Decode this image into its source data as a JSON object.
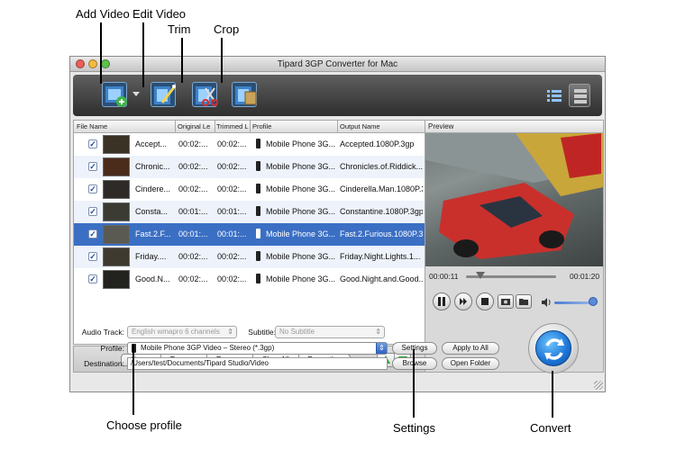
{
  "callouts": {
    "add_video": "Add Video",
    "edit_video": "Edit Video",
    "trim": "Trim",
    "crop": "Crop",
    "choose_profile": "Choose profile",
    "settings": "Settings",
    "convert": "Convert"
  },
  "window": {
    "title": "Tipard 3GP Converter for Mac"
  },
  "toolbar": {
    "icons": [
      "add-video-icon",
      "edit-video-icon",
      "trim-icon",
      "crop-icon",
      "snapshot-icon"
    ],
    "view_icons": [
      "list-view-icon",
      "detail-view-icon"
    ]
  },
  "file_list": {
    "headers": [
      "File Name",
      "Original Le",
      "Trimmed L",
      "Profile",
      "Output Name"
    ],
    "rows": [
      {
        "name": "Accept...",
        "original": "00:02:...",
        "trimmed": "00:02:...",
        "profile": "Mobile Phone 3G...",
        "output": "Accepted.1080P.3gp"
      },
      {
        "name": "Chronic...",
        "original": "00:02:...",
        "trimmed": "00:02:...",
        "profile": "Mobile Phone 3G...",
        "output": "Chronicles.of.Riddick...."
      },
      {
        "name": "Cindere...",
        "original": "00:02:...",
        "trimmed": "00:02:...",
        "profile": "Mobile Phone 3G...",
        "output": "Cinderella.Man.1080P.3..."
      },
      {
        "name": "Consta...",
        "original": "00:01:...",
        "trimmed": "00:01:...",
        "profile": "Mobile Phone 3G...",
        "output": "Constantine.1080P.3gp"
      },
      {
        "name": "Fast.2.F...",
        "original": "00:01:...",
        "trimmed": "00:01:...",
        "profile": "Mobile Phone 3G...",
        "output": "Fast.2.Furious.1080P.3gp"
      },
      {
        "name": "Friday....",
        "original": "00:02:...",
        "trimmed": "00:02:...",
        "profile": "Mobile Phone 3G...",
        "output": "Friday.Night.Lights.1..."
      },
      {
        "name": "Good.N...",
        "original": "00:02:...",
        "trimmed": "00:02:...",
        "profile": "Mobile Phone 3G...",
        "output": "Good.Night.and.Good..."
      }
    ],
    "selected_row": 4
  },
  "list_actions": {
    "merge": "Merge",
    "rename": "Rename",
    "remove": "Remove",
    "clear_all": "Clear All",
    "properties": "Properties"
  },
  "preview": {
    "header": "Preview",
    "time_current": "00:00:11",
    "time_total": "00:01:20",
    "position_fraction": 0.14,
    "volume_fraction": 0.9
  },
  "settings_area": {
    "audio_track_label": "Audio Track:",
    "audio_track_value": "English wmapro 6 channels",
    "subtitle_label": "Subtitle:",
    "subtitle_value": "No Subtitle",
    "profile_label": "Profile:",
    "profile_value": "Mobile Phone 3GP Video – Stereo (*.3gp)",
    "destination_label": "Destination:",
    "destination_value": "/Users/test/Documents/Tipard Studio/Video",
    "settings_button": "Settings",
    "apply_all_button": "Apply to All",
    "browse_button": "Browse",
    "open_folder_button": "Open Folder"
  },
  "colors": {
    "selection": "#3b6fc4",
    "accent_blue": "#1b74d6"
  }
}
